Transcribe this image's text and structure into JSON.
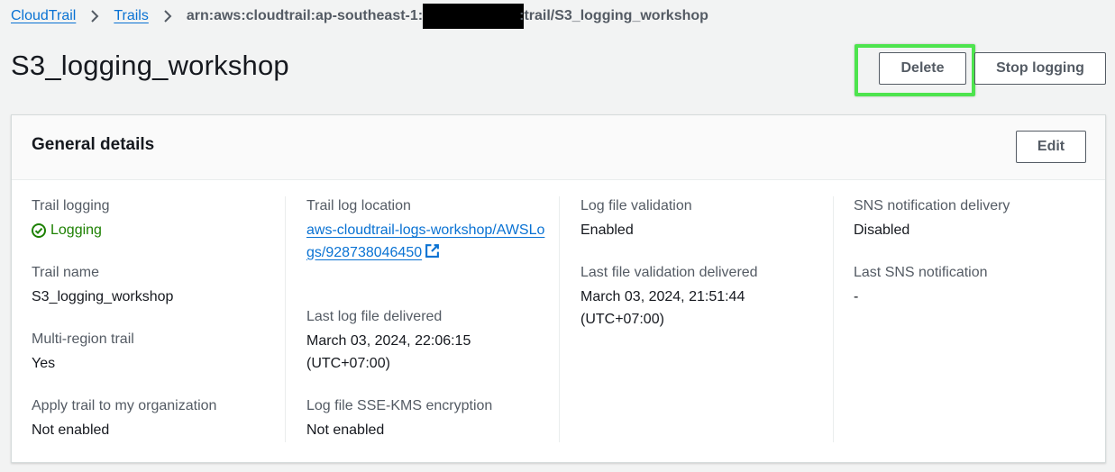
{
  "breadcrumb": {
    "root": "CloudTrail",
    "trails": "Trails",
    "arn_prefix": "arn:aws:cloudtrail:ap-southeast-1:",
    "arn_suffix": ":trail/S3_logging_workshop"
  },
  "page": {
    "title": "S3_logging_workshop",
    "delete_label": "Delete",
    "stop_logging_label": "Stop logging"
  },
  "general": {
    "title": "General details",
    "edit_label": "Edit",
    "trail_logging_label": "Trail logging",
    "trail_logging_value": "Logging",
    "trail_name_label": "Trail name",
    "trail_name_value": "S3_logging_workshop",
    "multi_region_label": "Multi-region trail",
    "multi_region_value": "Yes",
    "apply_org_label": "Apply trail to my organization",
    "apply_org_value": "Not enabled",
    "log_location_label": "Trail log location",
    "log_location_value": "aws-cloudtrail-logs-workshop/AWSLogs/928738046450",
    "last_log_label": "Last log file delivered",
    "last_log_value": "March 03, 2024, 22:06:15 (UTC+07:00)",
    "sse_kms_label": "Log file SSE-KMS encryption",
    "sse_kms_value": "Not enabled",
    "validation_label": "Log file validation",
    "validation_value": "Enabled",
    "last_validation_label": "Last file validation delivered",
    "last_validation_value": "March 03, 2024, 21:51:44 (UTC+07:00)",
    "sns_label": "SNS notification delivery",
    "sns_value": "Disabled",
    "last_sns_label": "Last SNS notification",
    "last_sns_value": "-"
  },
  "colors": {
    "link": "#0972d3",
    "success": "#1d8102",
    "highlight": "#4ee44e"
  },
  "icons": [
    "chevron-right-icon",
    "status-success-icon",
    "external-link-icon"
  ]
}
